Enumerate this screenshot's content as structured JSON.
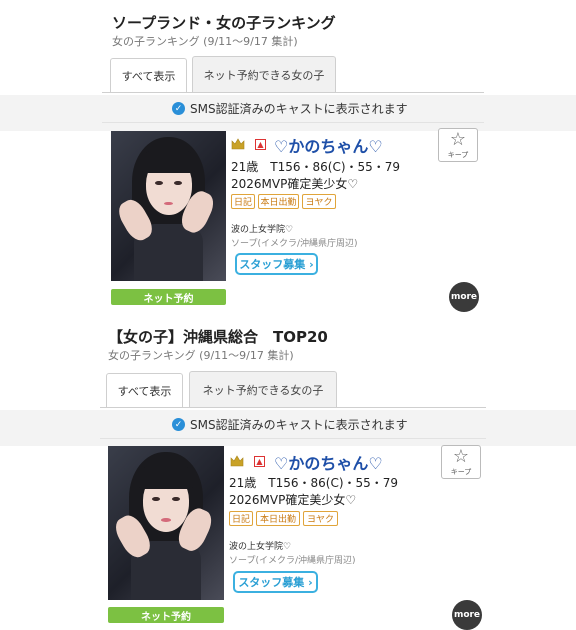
{
  "sections": [
    {
      "title": "ソープランド・女の子ランキング",
      "subtitle": "女の子ランキング (9/11〜9/17 集計)",
      "tabs": [
        "すべて表示",
        "ネット予約できる女の子"
      ],
      "sms_notice": "SMS認証済みのキャストに表示されます",
      "card": {
        "name": "♡かのちゃん♡",
        "stats": "21歳　T156・86(C)・55・79",
        "catchphrase": "2026MVP確定美少女♡",
        "badges": [
          "日記",
          "本日出勤",
          "ヨヤク"
        ],
        "shop_name": "波の上女学院♡",
        "shop_area": "ソープ(イメクラ/沖縄県庁周辺)",
        "staff_button": "スタッフ募集 ›",
        "keep_label": "キープ",
        "net_reserve": "ネット予約",
        "more": "more"
      }
    },
    {
      "title": "【女の子】沖縄県総合　TOP20",
      "subtitle": "女の子ランキング (9/11〜9/17 集計)",
      "tabs": [
        "すべて表示",
        "ネット予約できる女の子"
      ],
      "sms_notice": "SMS認証済みのキャストに表示されます",
      "card": {
        "name": "♡かのちゃん♡",
        "stats": "21歳　T156・86(C)・55・79",
        "catchphrase": "2026MVP確定美少女♡",
        "badges": [
          "日記",
          "本日出勤",
          "ヨヤク"
        ],
        "shop_name": "波の上女学院♡",
        "shop_area": "ソープ(イメクラ/沖縄県庁周辺)",
        "staff_button": "スタッフ募集 ›",
        "keep_label": "キープ",
        "net_reserve": "ネット予約",
        "more": "more"
      }
    }
  ],
  "icons": {
    "crown": "crown-icon",
    "rank_up": "rank-up-icon",
    "check": "verified-check-icon",
    "keep": "star-icon"
  },
  "colors": {
    "name": "#1e4fa8",
    "net_reserve": "#7cc142",
    "badge": "#e0a43a",
    "staff": "#3bb0e0",
    "sms_check": "#2a8fd8"
  }
}
